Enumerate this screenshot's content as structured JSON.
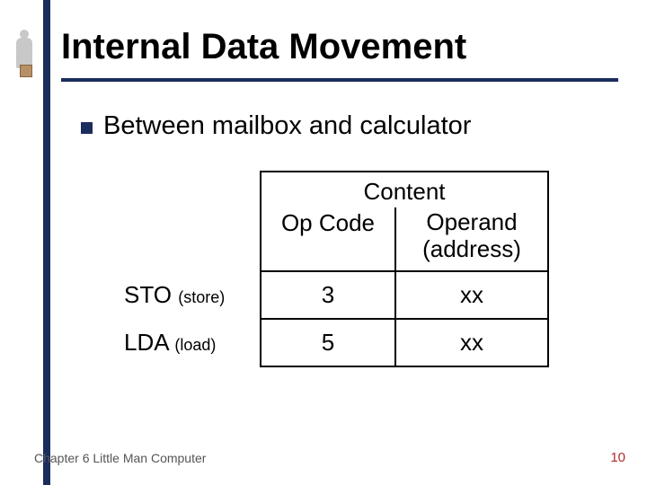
{
  "title": "Internal Data Movement",
  "bullet": "Between mailbox and calculator",
  "table": {
    "content_header": "Content",
    "opcode_header": "Op Code",
    "operand_header_l1": "Operand",
    "operand_header_l2": "(address)",
    "rows": [
      {
        "mnemonic": "STO",
        "meaning": "(store)",
        "opcode": "3",
        "operand": "xx"
      },
      {
        "mnemonic": "LDA",
        "meaning": "(load)",
        "opcode": "5",
        "operand": "xx"
      }
    ]
  },
  "footer": {
    "chapter": "Chapter 6 Little Man Computer",
    "page": "10"
  }
}
